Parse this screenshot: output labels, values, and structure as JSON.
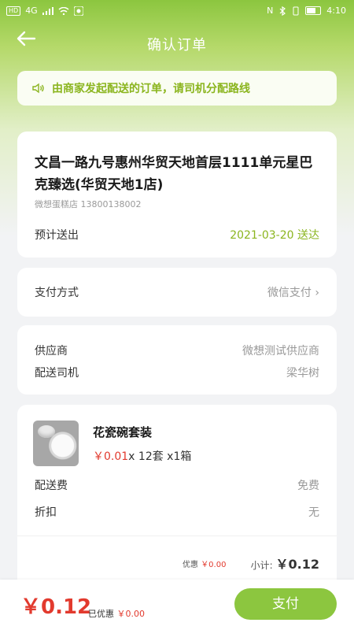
{
  "status_bar": {
    "left_chip": "HD",
    "network": "4G",
    "time": "4:10"
  },
  "header": {
    "title": "确认订单"
  },
  "notice": {
    "text": "由商家发起配送的订单，请司机分配路线"
  },
  "address": {
    "title": "文昌一路九号惠州华贸天地首层1111单元星巴克臻选(华贸天地1店)",
    "contact": "微想蛋糕店 13800138002",
    "eta_label": "预计送出",
    "eta_value": "2021-03-20 送达"
  },
  "payment": {
    "label": "支付方式",
    "value": "微信支付 ›"
  },
  "supplier": {
    "supplier_label": "供应商",
    "supplier_value": "微想测试供应商",
    "driver_label": "配送司机",
    "driver_value": "梁华树"
  },
  "product": {
    "name": "花瓷碗套装",
    "price": "￥0.01",
    "spec": "x 12套 x1箱",
    "delivery_label": "配送费",
    "delivery_value": "免费",
    "discount_label": "折扣",
    "discount_value": "无",
    "promo_label": "优惠",
    "promo_value": "￥0.00",
    "subtotal_label": "小计:",
    "subtotal_value": "￥0.12"
  },
  "footer": {
    "total": "￥0.12",
    "saved_label": "已优惠",
    "saved_value": "￥0.00",
    "pay_button": "支付"
  },
  "colors": {
    "accent": "#8cc63f",
    "price_red": "#e23a2e",
    "notice_green": "#8bb51f"
  }
}
